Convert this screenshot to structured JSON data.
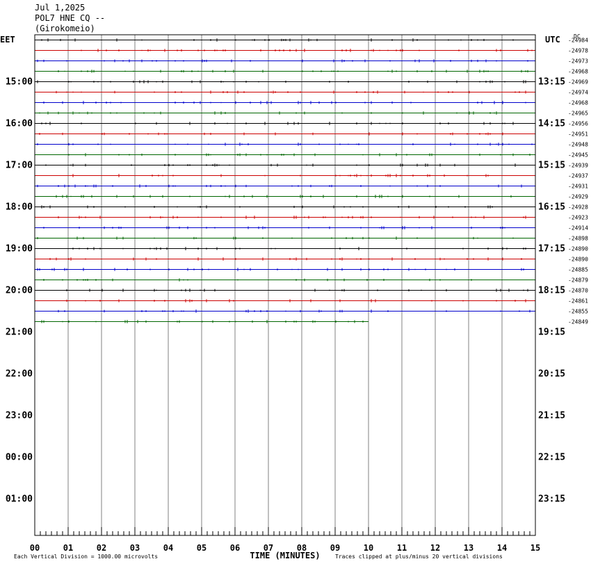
{
  "header": {
    "date": "Jul 1,2025",
    "station": "POL7 HNE CQ --",
    "location": "(Girokomeio)"
  },
  "chart_data": {
    "type": "line",
    "left_timezone": "EET",
    "right_timezone": "UTC",
    "dc_label": "DC",
    "xlabel": "TIME (MINUTES)",
    "xlim": [
      0,
      15
    ],
    "x_ticks": [
      "00",
      "01",
      "02",
      "03",
      "04",
      "05",
      "06",
      "07",
      "08",
      "09",
      "10",
      "11",
      "12",
      "13",
      "14",
      "15"
    ],
    "left_hour_labels": [
      "15:00",
      "16:00",
      "17:00",
      "18:00",
      "19:00",
      "20:00",
      "21:00",
      "22:00",
      "23:00",
      "00:00",
      "01:00"
    ],
    "right_hour_labels": [
      "13:15",
      "14:15",
      "15:15",
      "16:15",
      "17:15",
      "18:15",
      "19:15",
      "20:15",
      "21:15",
      "22:15",
      "23:15"
    ],
    "trace_colors": [
      "#000000",
      "#cc0000",
      "#0000cc",
      "#006600"
    ],
    "dc_offsets": [
      "24984",
      "24978",
      "24973",
      "24968",
      "24969",
      "24974",
      "24968",
      "24965",
      "24956",
      "24951",
      "24948",
      "24945",
      "24939",
      "24937",
      "24931",
      "24929",
      "24928",
      "24923",
      "24914",
      "24898",
      "24890",
      "24890",
      "24885",
      "24879",
      "24870",
      "24861",
      "24855",
      "24849"
    ],
    "last_trace_end_minute": 10,
    "footer_left": "Each Vertical Division = 1000.00 microvolts",
    "footer_right": "Traces clipped at plus/minus 20 vertical divisions"
  }
}
